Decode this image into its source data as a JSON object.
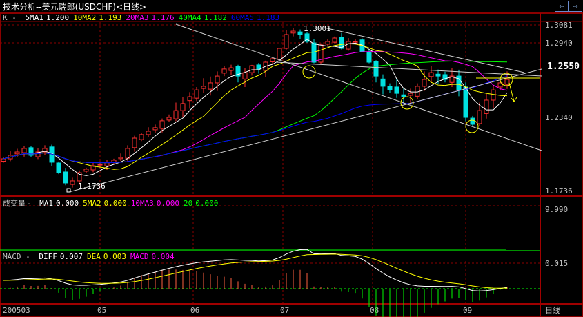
{
  "window": {
    "title": "技术分析--美元瑞郎(USDCHF)<日线>",
    "nav_left_icon": "arrow-left-icon",
    "nav_right_icon": "arrow-right-icon"
  },
  "price_legend": {
    "prefix": "K -",
    "items": [
      {
        "label": "5MA1",
        "value": "1.200",
        "color": "#ffffff"
      },
      {
        "label": "10MA2",
        "value": "1.193",
        "color": "#ffff00"
      },
      {
        "label": "20MA3",
        "value": "1.176",
        "color": "#ff00ff"
      },
      {
        "label": "40MA4",
        "value": "1.182",
        "color": "#00ff00"
      },
      {
        "label": "60MA5",
        "value": "1.183",
        "color": "#0000ff"
      }
    ]
  },
  "volume_legend": {
    "prefix": "成交量 -",
    "items": [
      {
        "label": "MA1",
        "value": "0.000",
        "color": "#ffffff"
      },
      {
        "label": "5MA2",
        "value": "0.000",
        "color": "#ffff00"
      },
      {
        "label": "10MA3",
        "value": "0.000",
        "color": "#ff00ff"
      },
      {
        "label": "20",
        "value": "0.000",
        "color": "#00ff00"
      }
    ]
  },
  "macd_legend": {
    "prefix": "MACD -",
    "items": [
      {
        "label": "DIFF",
        "value": "0.007",
        "color": "#ffffff"
      },
      {
        "label": "DEA",
        "value": "0.003",
        "color": "#ffff00"
      },
      {
        "label": "MACD",
        "value": "0.004",
        "color": "#ff00ff"
      }
    ]
  },
  "chart_data": {
    "type": "candlestick",
    "price_ticks": [
      "1.3081",
      "1.2940",
      "1.2550",
      "1.2340",
      "1.1736"
    ],
    "price_tick_values": [
      1.3081,
      1.294,
      1.255,
      1.234,
      1.1736
    ],
    "current_price_label": "1.2550",
    "annotations": {
      "high_label": "1.3001",
      "low_label": "1.1736"
    },
    "volume_tick": "9.990",
    "macd_tick": "0.015",
    "x_tick_labels": [
      "200503",
      "05",
      "06",
      "07",
      "08",
      "09"
    ],
    "period_label": "日线",
    "closes": [
      1.1998,
      1.2027,
      1.2055,
      1.2084,
      1.2027,
      1.2055,
      1.2084,
      1.197,
      1.1884,
      1.1799,
      1.1816,
      1.1884,
      1.1913,
      1.1941,
      1.1952,
      1.197,
      1.1987,
      1.2009,
      1.2084,
      1.2169,
      1.2198,
      1.2226,
      1.2255,
      1.2312,
      1.234,
      1.2368,
      1.2397,
      1.2425,
      1.2453,
      1.2468,
      1.2482,
      1.251,
      1.2539,
      1.2544,
      1.251,
      1.2524,
      1.2562,
      1.2539,
      1.2619,
      1.2676,
      1.2848,
      1.3005,
      1.3032,
      1.3005,
      1.2951,
      1.2619,
      1.2906,
      1.2951,
      1.2978,
      1.2848,
      1.2951,
      1.2951,
      1.2791,
      1.2619,
      1.251,
      1.2468,
      1.2453,
      1.2439,
      1.2425,
      1.2439,
      1.2468,
      1.2496,
      1.2524,
      1.251,
      1.2496,
      1.251,
      1.2453,
      1.234,
      1.2283,
      1.2368,
      1.2411,
      1.2453,
      1.2482,
      1.2496
    ],
    "ma_periods": [
      5,
      10,
      20,
      40,
      60
    ],
    "colors": {
      "up": "#ff3030",
      "down": "#00e0e0",
      "grid": "#8b0000",
      "axis": "#a00000"
    }
  }
}
